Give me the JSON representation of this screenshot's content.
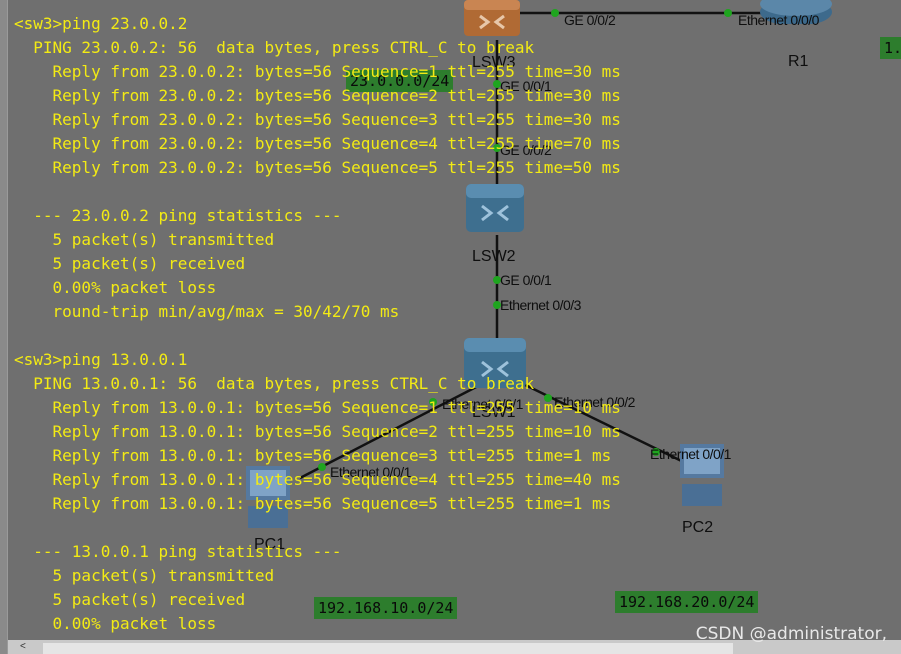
{
  "terminal": {
    "lines": [
      "<sw3>ping 23.0.0.2",
      "  PING 23.0.0.2: 56  data bytes, press CTRL_C to break",
      "    Reply from 23.0.0.2: bytes=56 Sequence=1 ttl=255 time=30 ms",
      "    Reply from 23.0.0.2: bytes=56 Sequence=2 ttl=255 time=30 ms",
      "    Reply from 23.0.0.2: bytes=56 Sequence=3 ttl=255 time=30 ms",
      "    Reply from 23.0.0.2: bytes=56 Sequence=4 ttl=255 time=70 ms",
      "    Reply from 23.0.0.2: bytes=56 Sequence=5 ttl=255 time=50 ms",
      "",
      "  --- 23.0.0.2 ping statistics ---",
      "    5 packet(s) transmitted",
      "    5 packet(s) received",
      "    0.00% packet loss",
      "    round-trip min/avg/max = 30/42/70 ms",
      "",
      "<sw3>ping 13.0.0.1",
      "  PING 13.0.0.1: 56  data bytes, press CTRL_C to break",
      "    Reply from 13.0.0.1: bytes=56 Sequence=1 ttl=255 time=10 ms",
      "    Reply from 13.0.0.1: bytes=56 Sequence=2 ttl=255 time=10 ms",
      "    Reply from 13.0.0.1: bytes=56 Sequence=3 ttl=255 time=1 ms",
      "    Reply from 13.0.0.1: bytes=56 Sequence=4 ttl=255 time=40 ms",
      "    Reply from 13.0.0.1: bytes=56 Sequence=5 ttl=255 time=1 ms",
      "",
      "  --- 13.0.0.1 ping statistics ---",
      "    5 packet(s) transmitted",
      "    5 packet(s) received",
      "    0.00% packet loss"
    ],
    "text_color": "#f3eb14"
  },
  "topology": {
    "devices": {
      "lsw3": "LSW3",
      "r1": "R1",
      "lsw2": "LSW2",
      "lsw1": "LSW1",
      "pc1": "PC1",
      "pc2": "PC2"
    },
    "ports": {
      "lsw3_ge002": "GE 0/0/2",
      "r1_eth000": "Ethernet 0/0/0",
      "lsw3_ge001": "GE 0/0/1",
      "lsw2_ge002": "GE 0/0/2",
      "lsw2_ge001": "GE 0/0/1",
      "lsw1_eth003": "Ethernet 0/0/3",
      "lsw1_eth001": "Ethernet 0/0/1",
      "lsw1_eth002": "Ethernet 0/0/2",
      "pc1_eth001": "Ethernet 0/0/1",
      "pc2_eth001": "Ethernet 0/0/1"
    },
    "networks": {
      "net_23": "23.0.0.0/24",
      "net_pc1": "192.168.10.0/24",
      "net_pc2": "192.168.20.0/24",
      "net_right": "1."
    },
    "link_color": "#111111",
    "port_dot_color": "#1fa51f",
    "net_label_color": "#2d7d2d"
  },
  "watermark": "CSDN @administrator,",
  "scrollbar": {
    "left_arrow": "<"
  }
}
